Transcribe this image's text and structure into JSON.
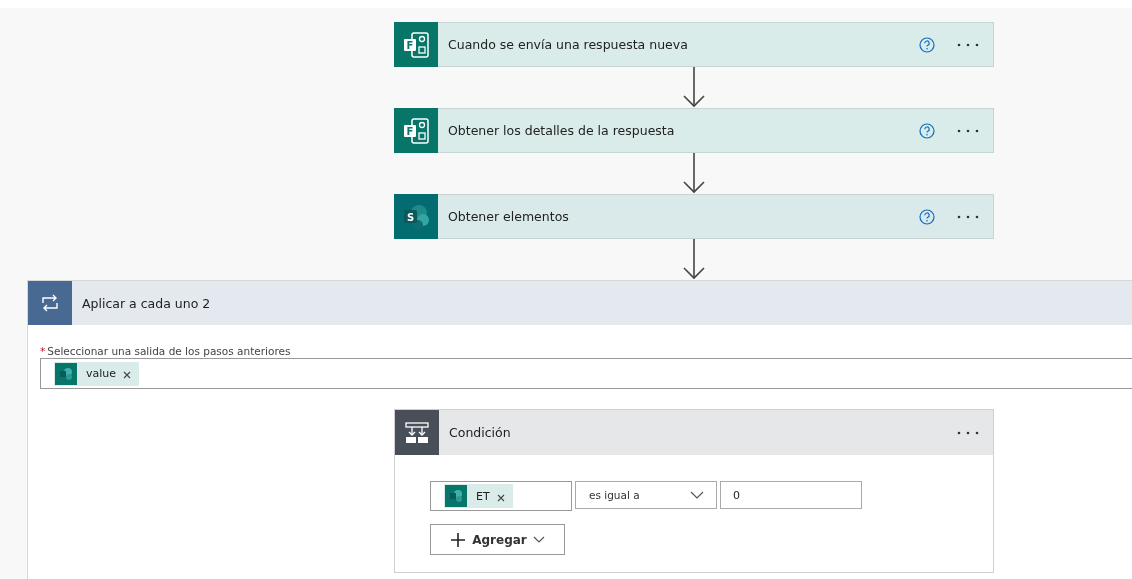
{
  "steps": [
    {
      "kind": "forms",
      "icon_text": "F",
      "title": "Cuando se envía una respuesta nueva"
    },
    {
      "kind": "forms",
      "icon_text": "F",
      "title": "Obtener los detalles de la respuesta"
    },
    {
      "kind": "sharepoint",
      "icon_text": "S",
      "title": "Obtener elementos"
    }
  ],
  "loop": {
    "title": "Aplicar a cada uno 2",
    "required_mark": "*",
    "field_label": "Seleccionar una salida de los pasos anteriores",
    "token": "value",
    "condition": {
      "title": "Condición",
      "token": "ET",
      "operator": "es igual a",
      "value": "0",
      "add_button": "Agregar"
    }
  }
}
